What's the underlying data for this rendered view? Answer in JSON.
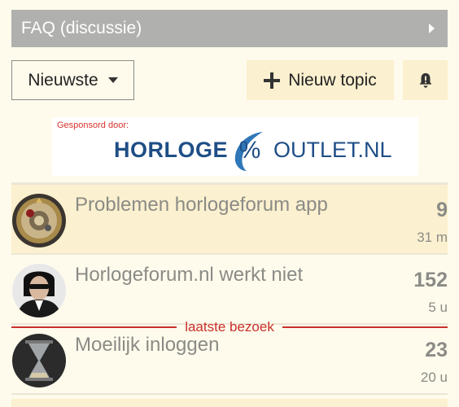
{
  "category": {
    "label": "FAQ (discussie)"
  },
  "controls": {
    "sort_label": "Nieuwste",
    "new_topic_label": "Nieuw topic"
  },
  "sponsor": {
    "label": "Gesponsord door:",
    "logo_text_1": "HORLOGE",
    "logo_symbol": "%",
    "logo_text_2": "OUTLET.NL"
  },
  "topics": [
    {
      "title": "Problemen horlogeforum app",
      "replies": "9",
      "age": "31 m"
    },
    {
      "title": "Horlogeforum.nl werkt niet",
      "replies": "152",
      "age": "5 u"
    },
    {
      "title": "Moeilijk inloggen",
      "replies": "23",
      "age": "20 u"
    }
  ],
  "last_visit_label": "laatste bezoek",
  "colors": {
    "background": "#fffbec",
    "category_bar": "#b0b0ae",
    "accent_button": "#fbf0cf",
    "last_visit_red": "#c8302c",
    "logo_blue": "#1f4e86"
  },
  "icons": {
    "category_arrow": "chevron-right-icon",
    "sort_caret": "caret-down-icon",
    "new_topic": "plus-icon",
    "notifications": "bell-icon"
  }
}
